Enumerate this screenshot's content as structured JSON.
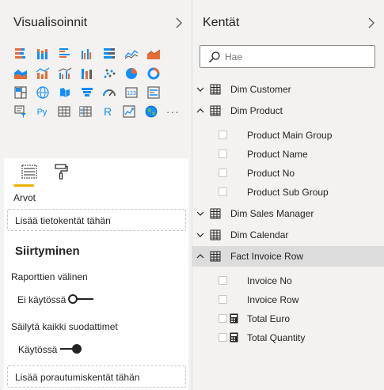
{
  "visualizations": {
    "title": "Visualisoinnit",
    "gallery_icons": [
      [
        "stacked-bar-chart-icon",
        "stacked-column-chart-icon",
        "clustered-bar-chart-icon",
        "clustered-column-chart-icon",
        "100-stacked-bar-chart-icon",
        "line-chart-icon",
        "area-chart-icon"
      ],
      [
        "stacked-area-chart-icon",
        "line-stacked-column-chart-icon",
        "line-clustered-column-chart-icon",
        "ribbon-chart-icon",
        "scatter-chart-icon",
        "pie-chart-icon",
        "donut-chart-icon"
      ],
      [
        "treemap-icon",
        "map-icon",
        "filled-map-icon",
        "funnel-icon",
        "gauge-icon",
        "card-icon",
        "multi-row-card-icon"
      ],
      [
        "slicer-icon",
        "python-visual-icon",
        "table-icon",
        "matrix-icon",
        "r-visual-icon",
        "kpi-icon",
        "globe-map-icon",
        "more-visuals-icon"
      ]
    ],
    "python_label": "Py",
    "r_label": "R",
    "more_label": "···",
    "values_label": "Arvot",
    "values_well": "Lisää tietokentät tähän",
    "drill_title": "Siirtyminen",
    "cross_report_label": "Raporttien välinen",
    "cross_report_state": "Ei käytössä",
    "keep_filters_label": "Säilytä kaikki suodattimet",
    "keep_filters_state": "Käytössä",
    "drill_well": "Lisää porautumiskentät tähän"
  },
  "fields": {
    "title": "Kentät",
    "search_placeholder": "Hae",
    "tables": [
      {
        "name": "Dim Customer",
        "expanded": false
      },
      {
        "name": "Dim Product",
        "expanded": true
      },
      {
        "name": "Dim Sales Manager",
        "expanded": false
      },
      {
        "name": "Dim Calendar",
        "expanded": false
      },
      {
        "name": "Fact Invoice Row",
        "expanded": true,
        "selected": true
      }
    ],
    "product_fields": [
      "Product Main Group",
      "Product Name",
      "Product No",
      "Product Sub Group"
    ],
    "invoice_fields": [
      "Invoice No",
      "Invoice Row"
    ],
    "invoice_measures": [
      "Total Euro",
      "Total Quantity"
    ]
  },
  "colors": {
    "accent": "#e8b200",
    "panel_bg": "#f3f2f1",
    "selected_row": "#dcdcdc"
  }
}
